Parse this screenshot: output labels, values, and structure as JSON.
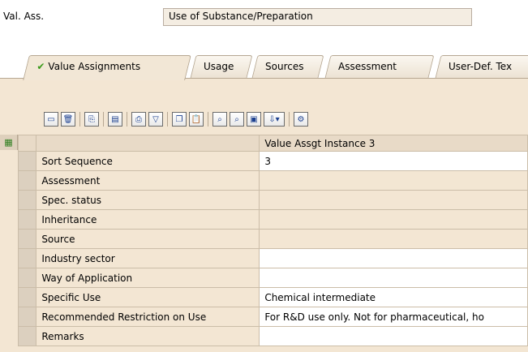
{
  "header": {
    "label": "Val. Ass.",
    "value": "Use of Substance/Preparation"
  },
  "tabs": [
    {
      "label": "Value Assignments",
      "active": true
    },
    {
      "label": "Usage"
    },
    {
      "label": "Sources"
    },
    {
      "label": "Assessment"
    },
    {
      "label": "User-Def. Tex"
    }
  ],
  "toolbar": {
    "icons": [
      "new-icon",
      "delete-icon",
      "copy-icon",
      "insert-icon",
      "print-icon",
      "filter-icon",
      "copy-doc-icon",
      "paste-icon",
      "find-icon",
      "find-next-icon",
      "print-preview-icon",
      "export-icon",
      "settings-icon"
    ]
  },
  "grid": {
    "column_header": "Value Assgt Instance 3",
    "rows": [
      {
        "name": "Sort Sequence",
        "value": "3",
        "bg": "white"
      },
      {
        "name": "Assessment",
        "value": "",
        "bg": "tan"
      },
      {
        "name": "Spec. status",
        "value": "",
        "bg": "tan"
      },
      {
        "name": "Inheritance",
        "value": "",
        "bg": "tan"
      },
      {
        "name": "Source",
        "value": "",
        "bg": "tan"
      },
      {
        "name": "Industry sector",
        "value": "",
        "bg": "white"
      },
      {
        "name": "Way of Application",
        "value": "",
        "bg": "white"
      },
      {
        "name": "Specific Use",
        "value": "Chemical intermediate",
        "bg": "white"
      },
      {
        "name": "Recommended Restriction on Use",
        "value": "For R&D use only. Not for pharmaceutical, ho",
        "bg": "white"
      },
      {
        "name": "Remarks",
        "value": "",
        "bg": "white"
      }
    ]
  }
}
